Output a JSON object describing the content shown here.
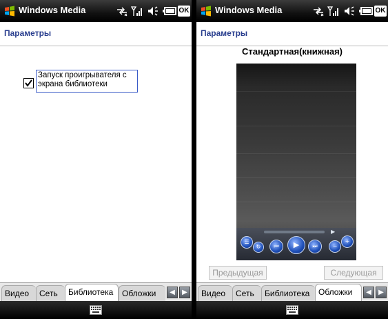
{
  "left_screen": {
    "titlebar": {
      "title": "Windows Media",
      "ok_label": "OK"
    },
    "page_title": "Параметры",
    "checkbox": {
      "label": "Запуск проигрывателя с экрана библиотеки",
      "checked": true
    },
    "tabs": [
      {
        "label": "Видео",
        "active": false
      },
      {
        "label": "Сеть",
        "active": false
      },
      {
        "label": "Библиотека",
        "active": true
      },
      {
        "label": "Обложки",
        "active": false
      }
    ]
  },
  "right_screen": {
    "titlebar": {
      "title": "Windows Media",
      "ok_label": "OK"
    },
    "page_title": "Параметры",
    "skin_title": "Стандартная(книжная)",
    "buttons": {
      "prev_label": "Предыдущая",
      "next_label": "Следующая"
    },
    "tabs": [
      {
        "label": "Видео",
        "active": false
      },
      {
        "label": "Сеть",
        "active": false
      },
      {
        "label": "Библиотека",
        "active": false
      },
      {
        "label": "Обложки",
        "active": true
      }
    ]
  },
  "icons": [
    "windows-flag-icon",
    "connectivity-icon",
    "signal-icon",
    "speaker-icon",
    "battery-icon",
    "keyboard-icon",
    "scroll-left-icon",
    "scroll-right-icon"
  ],
  "colors": {
    "titlebar": "#111111",
    "page_title": "#2a3f8f",
    "focus_border": "#3a5bc7",
    "disabled_text": "#9a9a9a"
  }
}
